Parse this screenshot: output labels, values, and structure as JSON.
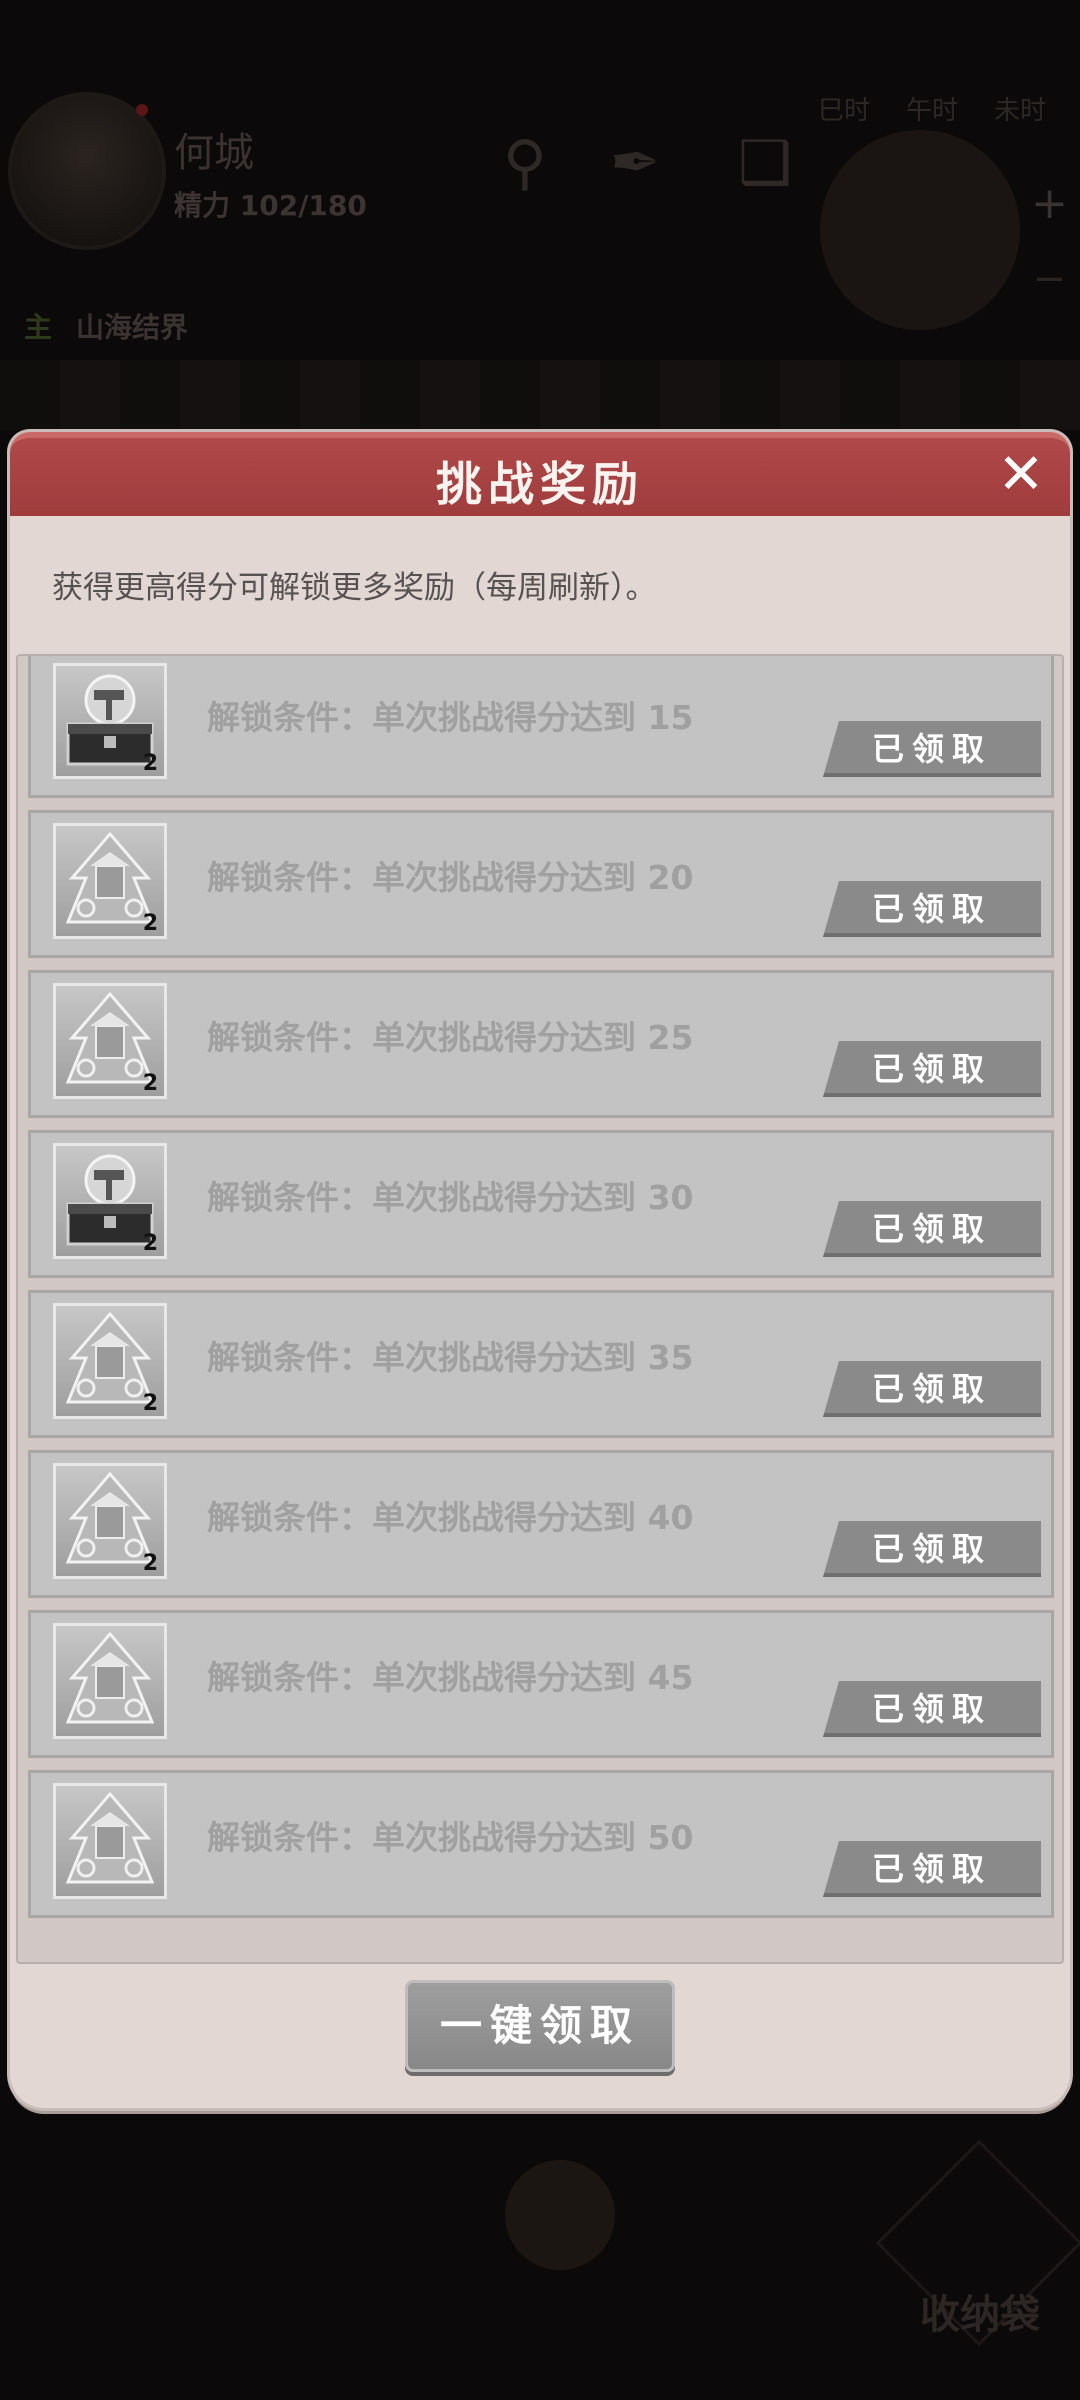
{
  "background": {
    "player_name": "何城",
    "energy": "精力 102/180",
    "time_tabs": [
      "巳时",
      "午时",
      "未时"
    ],
    "task_tag": "主",
    "task_label": "山海结界",
    "bag_label": "收纳袋"
  },
  "dialog": {
    "title": "挑战奖励",
    "subtitle": "获得更高得分可解锁更多奖励（每周刷新）。",
    "claim_all_label": "一键领取",
    "rows": [
      {
        "icon": "chest-hammer-icon",
        "count": "2",
        "condition": "解锁条件：单次挑战得分达到 15",
        "status": "已领取"
      },
      {
        "icon": "temple-emblem-icon",
        "count": "2",
        "condition": "解锁条件：单次挑战得分达到 20",
        "status": "已领取"
      },
      {
        "icon": "temple-emblem-icon",
        "count": "2",
        "condition": "解锁条件：单次挑战得分达到 25",
        "status": "已领取"
      },
      {
        "icon": "chest-hammer-icon",
        "count": "2",
        "condition": "解锁条件：单次挑战得分达到 30",
        "status": "已领取"
      },
      {
        "icon": "temple-emblem-icon",
        "count": "2",
        "condition": "解锁条件：单次挑战得分达到 35",
        "status": "已领取"
      },
      {
        "icon": "temple-emblem-icon",
        "count": "2",
        "condition": "解锁条件：单次挑战得分达到 40",
        "status": "已领取"
      },
      {
        "icon": "temple-emblem-icon",
        "count": "",
        "condition": "解锁条件：单次挑战得分达到 45",
        "status": "已领取"
      },
      {
        "icon": "temple-emblem-icon",
        "count": "",
        "condition": "解锁条件：单次挑战得分达到 50",
        "status": "已领取"
      }
    ]
  },
  "colors": {
    "header_red": "#a8403f",
    "dialog_bg": "#e2d7d3",
    "row_bg": "#c3c3c3",
    "claimed_btn": "#8a8a8a"
  }
}
